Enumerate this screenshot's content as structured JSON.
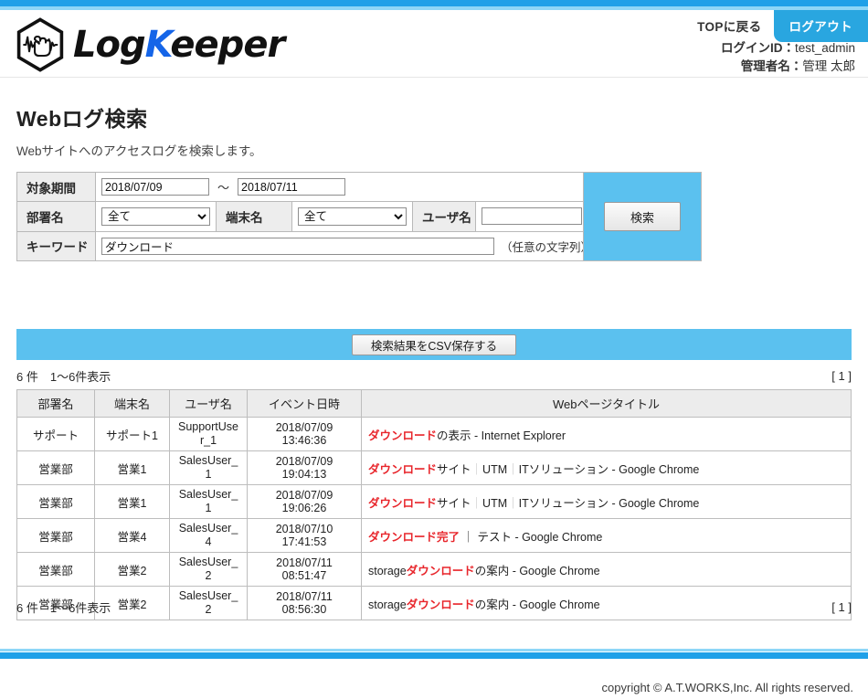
{
  "header": {
    "brand_light": "Log",
    "brand_accent_k": "K",
    "brand_dark_tail": "eeper",
    "logo_icon": "hexagon-fist-waveform-logo",
    "top_return_label": "TOPに戻る",
    "logout_label": "ログアウト",
    "login_id_label": "ログインID：",
    "login_id_value": "test_admin",
    "admin_name_label": "管理者名：",
    "admin_name_value": "管理 太郎"
  },
  "page": {
    "title": "Webログ検索",
    "description": "Webサイトへのアクセスログを検索します。"
  },
  "search": {
    "period_label": "対象期間",
    "period_from": "2018/07/09",
    "period_to": "2018/07/11",
    "period_separator": "〜",
    "dept_label": "部署名",
    "dept_value": "全て",
    "dept_options": [
      "全て"
    ],
    "terminal_label": "端末名",
    "terminal_value": "全て",
    "terminal_options": [
      "全て"
    ],
    "user_label": "ユーザ名",
    "user_value": "",
    "keyword_label": "キーワード",
    "keyword_value": "ダウンロード",
    "keyword_note": "（任意の文字列）",
    "search_button_label": "検索",
    "accent_color": "#5bc1ef"
  },
  "results": {
    "csv_button_label": "検索結果をCSV保存する",
    "count_text": "6 件　1〜6件表示",
    "pager_open": "[ ",
    "pager_page": "1",
    "pager_close": " ]",
    "columns": [
      "部署名",
      "端末名",
      "ユーザ名",
      "イベント日時",
      "Webページタイトル"
    ],
    "rows": [
      {
        "dept": "サポート",
        "terminal": "サポート1",
        "user": "SupportUser_1",
        "datetime": "2018/07/09 13:46:36",
        "title_parts": [
          {
            "text": "ダウンロード",
            "style": "highlight"
          },
          {
            "text": "の表示 - Internet Explorer",
            "style": "plain"
          }
        ]
      },
      {
        "dept": "営業部",
        "terminal": "営業1",
        "user": "SalesUser_1",
        "datetime": "2018/07/09 19:04:13",
        "title_parts": [
          {
            "text": "ダウンロード",
            "style": "highlight"
          },
          {
            "text": "サイト",
            "style": "plain"
          },
          {
            "text": "｜",
            "style": "separator"
          },
          {
            "text": "UTM",
            "style": "plain"
          },
          {
            "text": "｜",
            "style": "separator"
          },
          {
            "text": "ITソリューション - Google Chrome",
            "style": "plain"
          }
        ]
      },
      {
        "dept": "営業部",
        "terminal": "営業1",
        "user": "SalesUser_1",
        "datetime": "2018/07/09 19:06:26",
        "title_parts": [
          {
            "text": "ダウンロード",
            "style": "highlight"
          },
          {
            "text": "サイト",
            "style": "plain"
          },
          {
            "text": "｜",
            "style": "separator"
          },
          {
            "text": "UTM",
            "style": "plain"
          },
          {
            "text": "｜",
            "style": "separator"
          },
          {
            "text": "ITソリューション - Google Chrome",
            "style": "plain"
          }
        ]
      },
      {
        "dept": "営業部",
        "terminal": "営業4",
        "user": "SalesUser_4",
        "datetime": "2018/07/10 17:41:53",
        "title_parts": [
          {
            "text": "ダウンロード",
            "style": "highlight"
          },
          {
            "text": "完了",
            "style": "highlight"
          },
          {
            "text": " ｜ テスト - Google Chrome",
            "style": "plain"
          }
        ]
      },
      {
        "dept": "営業部",
        "terminal": "営業2",
        "user": "SalesUser_2",
        "datetime": "2018/07/11 08:51:47",
        "title_parts": [
          {
            "text": "storage",
            "style": "plain"
          },
          {
            "text": "ダウンロード",
            "style": "highlight"
          },
          {
            "text": "の案内 - Google Chrome",
            "style": "plain"
          }
        ]
      },
      {
        "dept": "営業部",
        "terminal": "営業2",
        "user": "SalesUser_2",
        "datetime": "2018/07/11 08:56:30",
        "title_parts": [
          {
            "text": "storage",
            "style": "plain"
          },
          {
            "text": "ダウンロード",
            "style": "highlight"
          },
          {
            "text": "の案内 - Google Chrome",
            "style": "plain"
          }
        ]
      }
    ]
  },
  "footer": {
    "copyright": "copyright © A.T.WORKS,Inc. All rights reserved."
  }
}
